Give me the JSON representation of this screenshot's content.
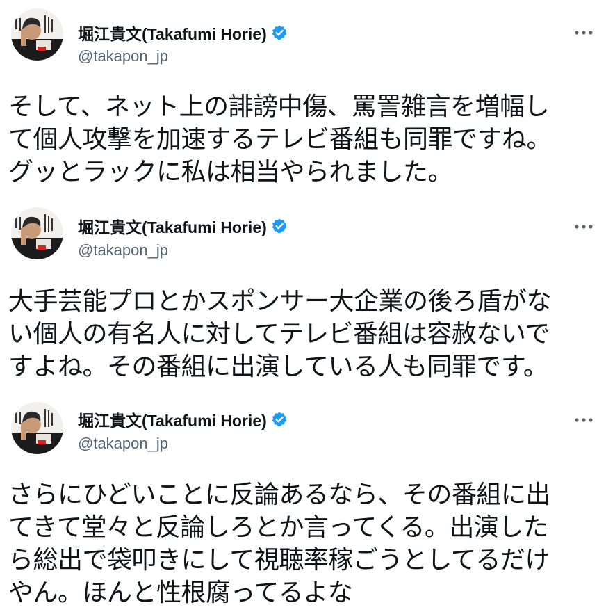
{
  "tweets": [
    {
      "display_name": "堀江貴文(Takafumi Horie)",
      "handle": "@takapon_jp",
      "verified_icon": "verified-badge-icon",
      "more_icon": "more-options-icon",
      "lines": [
        "そして、ネット上の誹謗中傷、罵詈雑言を増幅し",
        "て個人攻撃を加速するテレビ番組も同罪ですね。",
        "グッとラックに私は相当やられました。"
      ]
    },
    {
      "display_name": "堀江貴文(Takafumi Horie)",
      "handle": "@takapon_jp",
      "verified_icon": "verified-badge-icon",
      "more_icon": "more-options-icon",
      "lines": [
        "大手芸能プロとかスポンサー大企業の後ろ盾がな",
        "い個人の有名人に対してテレビ番組は容赦ないで",
        "すよね。その番組に出演している人も同罪です。"
      ]
    },
    {
      "display_name": "堀江貴文(Takafumi Horie)",
      "handle": "@takapon_jp",
      "verified_icon": "verified-badge-icon",
      "more_icon": "more-options-icon",
      "lines": [
        "さらにひどいことに反論あるなら、その番組に出",
        "てきて堂々と反論しろとか言ってくる。出演した",
        "ら総出で袋叩きにして視聴率稼ごうとしてるだけ",
        "やん。ほんと性根腐ってるよな"
      ]
    }
  ],
  "colors": {
    "verified": "#1d9bf0",
    "handle": "#536471",
    "text": "#0f1419",
    "more": "#536471"
  }
}
